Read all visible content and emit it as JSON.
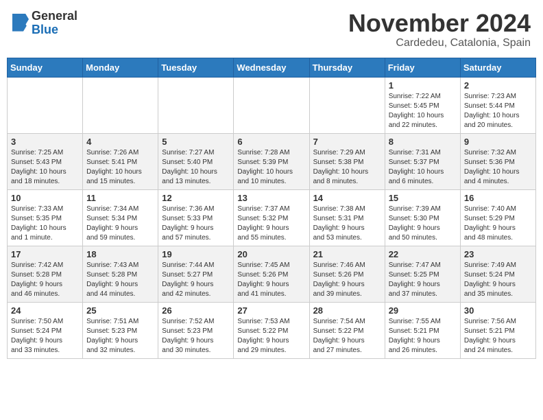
{
  "logo": {
    "general": "General",
    "blue": "Blue"
  },
  "header": {
    "month": "November 2024",
    "location": "Cardedeu, Catalonia, Spain"
  },
  "weekdays": [
    "Sunday",
    "Monday",
    "Tuesday",
    "Wednesday",
    "Thursday",
    "Friday",
    "Saturday"
  ],
  "weeks": [
    [
      {
        "day": "",
        "info": ""
      },
      {
        "day": "",
        "info": ""
      },
      {
        "day": "",
        "info": ""
      },
      {
        "day": "",
        "info": ""
      },
      {
        "day": "",
        "info": ""
      },
      {
        "day": "1",
        "info": "Sunrise: 7:22 AM\nSunset: 5:45 PM\nDaylight: 10 hours\nand 22 minutes."
      },
      {
        "day": "2",
        "info": "Sunrise: 7:23 AM\nSunset: 5:44 PM\nDaylight: 10 hours\nand 20 minutes."
      }
    ],
    [
      {
        "day": "3",
        "info": "Sunrise: 7:25 AM\nSunset: 5:43 PM\nDaylight: 10 hours\nand 18 minutes."
      },
      {
        "day": "4",
        "info": "Sunrise: 7:26 AM\nSunset: 5:41 PM\nDaylight: 10 hours\nand 15 minutes."
      },
      {
        "day": "5",
        "info": "Sunrise: 7:27 AM\nSunset: 5:40 PM\nDaylight: 10 hours\nand 13 minutes."
      },
      {
        "day": "6",
        "info": "Sunrise: 7:28 AM\nSunset: 5:39 PM\nDaylight: 10 hours\nand 10 minutes."
      },
      {
        "day": "7",
        "info": "Sunrise: 7:29 AM\nSunset: 5:38 PM\nDaylight: 10 hours\nand 8 minutes."
      },
      {
        "day": "8",
        "info": "Sunrise: 7:31 AM\nSunset: 5:37 PM\nDaylight: 10 hours\nand 6 minutes."
      },
      {
        "day": "9",
        "info": "Sunrise: 7:32 AM\nSunset: 5:36 PM\nDaylight: 10 hours\nand 4 minutes."
      }
    ],
    [
      {
        "day": "10",
        "info": "Sunrise: 7:33 AM\nSunset: 5:35 PM\nDaylight: 10 hours\nand 1 minute."
      },
      {
        "day": "11",
        "info": "Sunrise: 7:34 AM\nSunset: 5:34 PM\nDaylight: 9 hours\nand 59 minutes."
      },
      {
        "day": "12",
        "info": "Sunrise: 7:36 AM\nSunset: 5:33 PM\nDaylight: 9 hours\nand 57 minutes."
      },
      {
        "day": "13",
        "info": "Sunrise: 7:37 AM\nSunset: 5:32 PM\nDaylight: 9 hours\nand 55 minutes."
      },
      {
        "day": "14",
        "info": "Sunrise: 7:38 AM\nSunset: 5:31 PM\nDaylight: 9 hours\nand 53 minutes."
      },
      {
        "day": "15",
        "info": "Sunrise: 7:39 AM\nSunset: 5:30 PM\nDaylight: 9 hours\nand 50 minutes."
      },
      {
        "day": "16",
        "info": "Sunrise: 7:40 AM\nSunset: 5:29 PM\nDaylight: 9 hours\nand 48 minutes."
      }
    ],
    [
      {
        "day": "17",
        "info": "Sunrise: 7:42 AM\nSunset: 5:28 PM\nDaylight: 9 hours\nand 46 minutes."
      },
      {
        "day": "18",
        "info": "Sunrise: 7:43 AM\nSunset: 5:28 PM\nDaylight: 9 hours\nand 44 minutes."
      },
      {
        "day": "19",
        "info": "Sunrise: 7:44 AM\nSunset: 5:27 PM\nDaylight: 9 hours\nand 42 minutes."
      },
      {
        "day": "20",
        "info": "Sunrise: 7:45 AM\nSunset: 5:26 PM\nDaylight: 9 hours\nand 41 minutes."
      },
      {
        "day": "21",
        "info": "Sunrise: 7:46 AM\nSunset: 5:26 PM\nDaylight: 9 hours\nand 39 minutes."
      },
      {
        "day": "22",
        "info": "Sunrise: 7:47 AM\nSunset: 5:25 PM\nDaylight: 9 hours\nand 37 minutes."
      },
      {
        "day": "23",
        "info": "Sunrise: 7:49 AM\nSunset: 5:24 PM\nDaylight: 9 hours\nand 35 minutes."
      }
    ],
    [
      {
        "day": "24",
        "info": "Sunrise: 7:50 AM\nSunset: 5:24 PM\nDaylight: 9 hours\nand 33 minutes."
      },
      {
        "day": "25",
        "info": "Sunrise: 7:51 AM\nSunset: 5:23 PM\nDaylight: 9 hours\nand 32 minutes."
      },
      {
        "day": "26",
        "info": "Sunrise: 7:52 AM\nSunset: 5:23 PM\nDaylight: 9 hours\nand 30 minutes."
      },
      {
        "day": "27",
        "info": "Sunrise: 7:53 AM\nSunset: 5:22 PM\nDaylight: 9 hours\nand 29 minutes."
      },
      {
        "day": "28",
        "info": "Sunrise: 7:54 AM\nSunset: 5:22 PM\nDaylight: 9 hours\nand 27 minutes."
      },
      {
        "day": "29",
        "info": "Sunrise: 7:55 AM\nSunset: 5:21 PM\nDaylight: 9 hours\nand 26 minutes."
      },
      {
        "day": "30",
        "info": "Sunrise: 7:56 AM\nSunset: 5:21 PM\nDaylight: 9 hours\nand 24 minutes."
      }
    ]
  ]
}
